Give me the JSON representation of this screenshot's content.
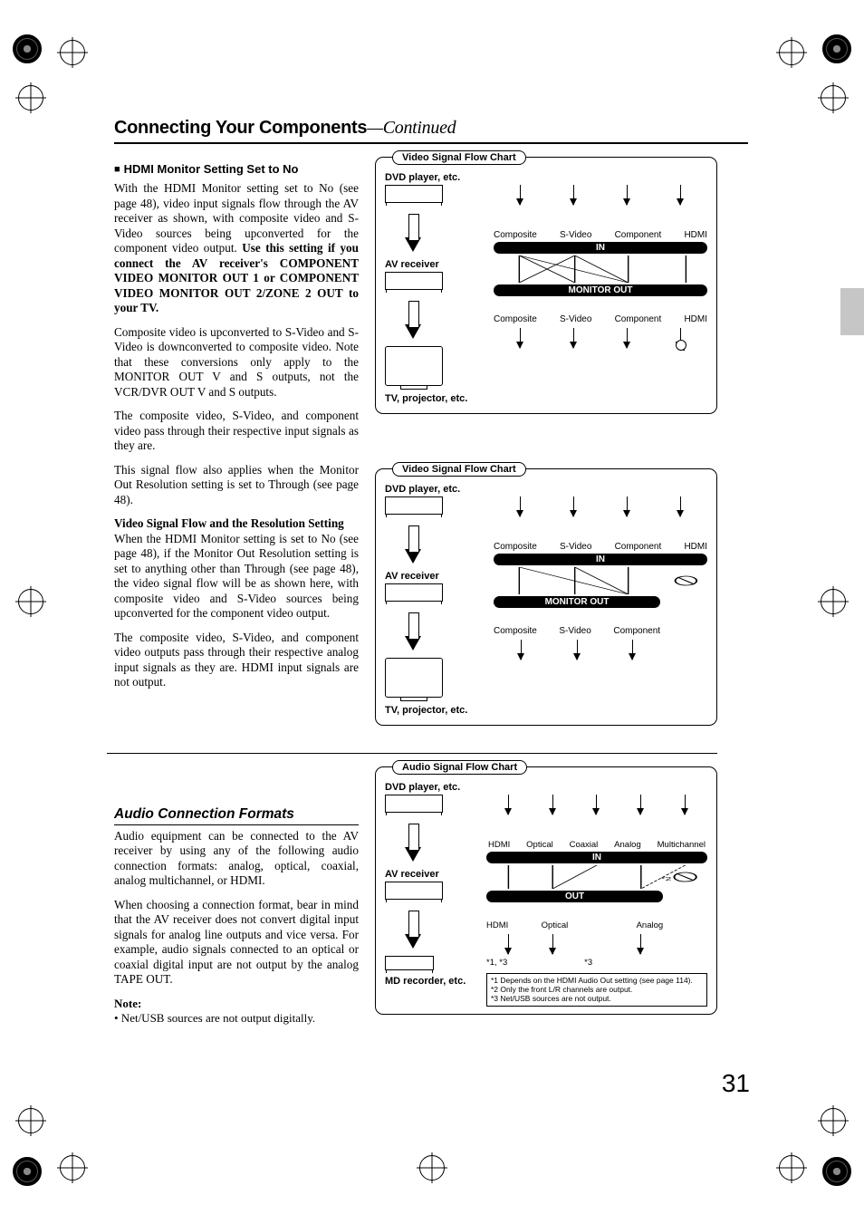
{
  "page": {
    "title_bold": "Connecting Your Components",
    "title_em": "—Continued",
    "number": "31"
  },
  "section_hdmi": {
    "heading": "HDMI Monitor Setting Set to No",
    "p1a": "With the HDMI Monitor setting set to No (see page 48), video input signals flow through the AV receiver as shown, with composite video and S-Video sources being upconverted for the component video output. ",
    "p1b": "Use this setting if you connect the AV receiver's COMPONENT VIDEO MONITOR OUT 1 or COMPONENT VIDEO MONITOR OUT 2/ZONE 2 OUT to your TV.",
    "p2": "Composite video is upconverted to S-Video and S-Video is downconverted to composite video. Note that these conversions only apply to the MONITOR OUT V and S outputs, not the VCR/DVR OUT V and S outputs.",
    "p3": "The composite video, S-Video, and component video pass through their respective input signals as they are.",
    "p4": "This signal flow also applies when the Monitor Out Resolution setting is set to Through (see page 48).",
    "sub2": "Video Signal Flow and the Resolution Setting",
    "p5": "When the HDMI Monitor setting is set to No (see page 48), if the Monitor Out Resolution setting is set to anything other than Through (see page 48), the video signal flow will be as shown here, with composite video and S-Video sources being upconverted for the component video output.",
    "p6": "The composite video, S-Video, and component video outputs pass through their respective analog input signals as they are. HDMI input signals are not output."
  },
  "section_audio": {
    "heading": "Audio Connection Formats",
    "p1": "Audio equipment can be connected to the AV receiver by using any of the following audio connection formats: analog, optical, coaxial, analog multichannel, or HDMI.",
    "p2": "When choosing a connection format, bear in mind that the AV receiver does not convert digital input signals for analog line outputs and vice versa. For example, audio signals connected to an optical or coaxial digital input are not output by the analog TAPE OUT.",
    "note_head": "Note:",
    "note_item": "• Net/USB sources are not output digitally."
  },
  "flow": {
    "video_title": "Video Signal Flow Chart",
    "audio_title": "Audio Signal Flow Chart",
    "dvd": "DVD player, etc.",
    "av": "AV receiver",
    "tv": "TV, projector, etc.",
    "md": "MD recorder, etc.",
    "in": "IN",
    "out": "OUT",
    "monitor_out": "MONITOR OUT",
    "composite": "Composite",
    "svideo": "S-Video",
    "component": "Component",
    "hdmi": "HDMI",
    "optical": "Optical",
    "coaxial": "Coaxial",
    "analog": "Analog",
    "multichannel": "Multichannel",
    "foot1": "*1  Depends on the HDMI Audio Out setting (see page 114).",
    "foot2": "*2  Only the front L/R channels are output.",
    "foot3": "*3  Net/USB sources are not output.",
    "star13": "*1, *3",
    "star3": "*3",
    "star2": "*2"
  }
}
